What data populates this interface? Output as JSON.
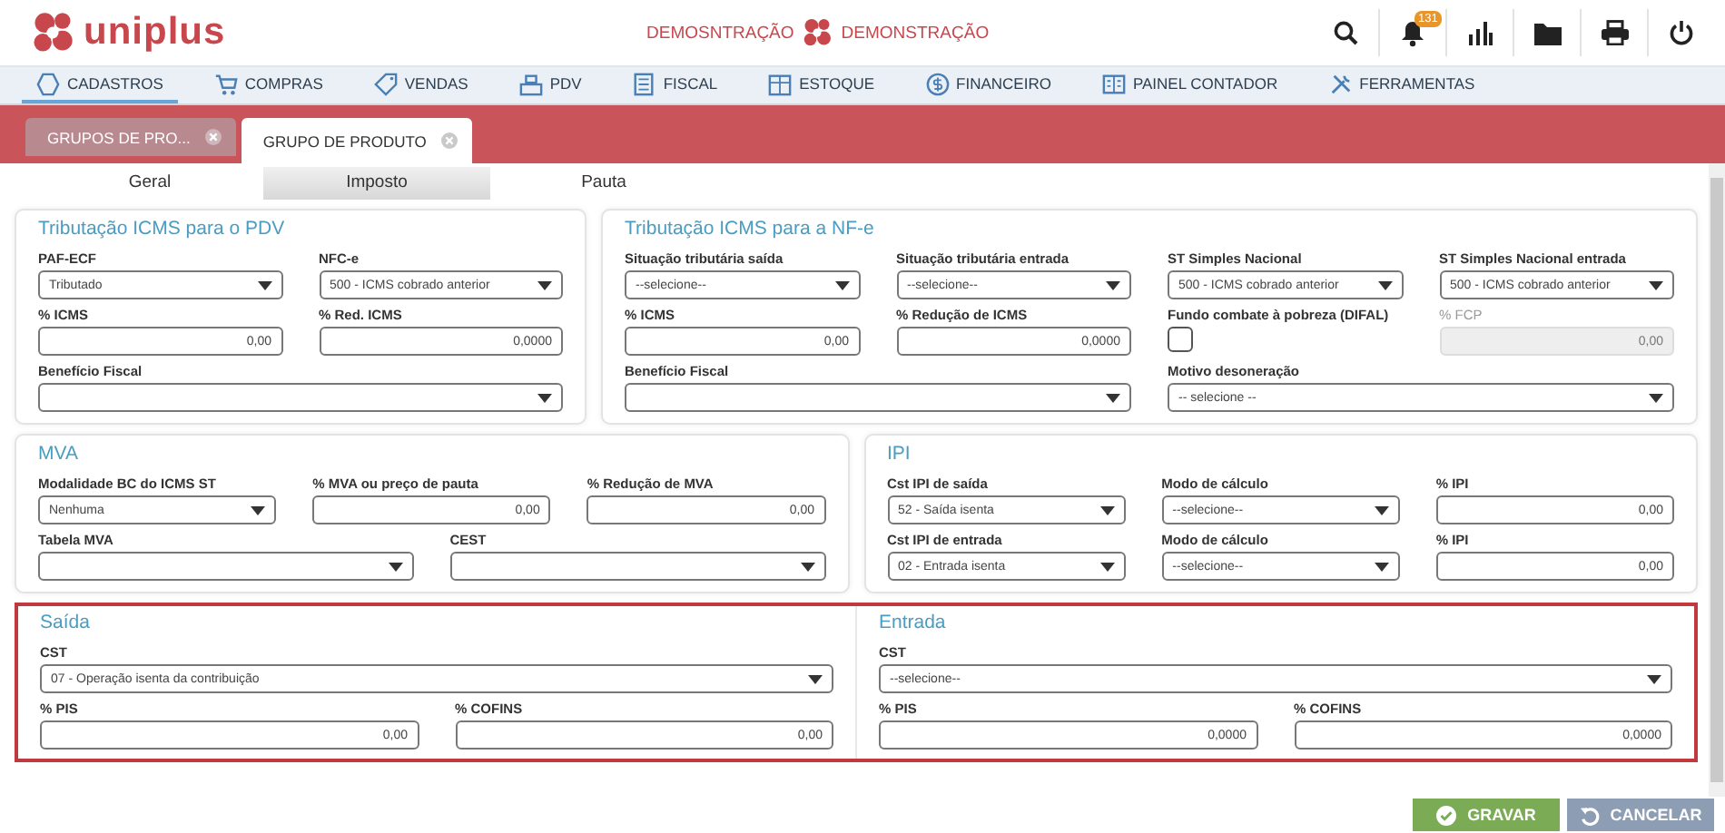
{
  "header": {
    "logo_text": "uniplus",
    "company_left": "DEMOSNTRAÇÃO",
    "company_right": "DEMONSTRAÇÃO",
    "notification_count": "131"
  },
  "nav": [
    {
      "label": "CADASTROS",
      "selected": true
    },
    {
      "label": "COMPRAS",
      "selected": false
    },
    {
      "label": "VENDAS",
      "selected": false
    },
    {
      "label": "PDV",
      "selected": false
    },
    {
      "label": "FISCAL",
      "selected": false
    },
    {
      "label": "ESTOQUE",
      "selected": false
    },
    {
      "label": "FINANCEIRO",
      "selected": false
    },
    {
      "label": "PAINEL CONTADOR",
      "selected": false
    },
    {
      "label": "FERRAMENTAS",
      "selected": false
    }
  ],
  "doc_tabs": [
    {
      "label": "GRUPOS DE PRO...",
      "selected": false
    },
    {
      "label": "GRUPO DE PRODUTO",
      "selected": true
    }
  ],
  "form_tabs": [
    {
      "label": "Geral",
      "selected": false
    },
    {
      "label": "Imposto",
      "selected": true
    },
    {
      "label": "Pauta",
      "selected": false
    }
  ],
  "sections": [
    {
      "highlighted": false,
      "panels": [
        {
          "title": "Tributação ICMS para o PDV",
          "field_lines": [
            {
              "fields": [
                {
                  "label": "PAF-ECF",
                  "kind": "select",
                  "value": "Tributado"
                },
                {
                  "label": "NFC-e",
                  "kind": "select",
                  "value": "500 - ICMS cobrado anterior"
                }
              ]
            },
            {
              "fields": [
                {
                  "label": "% ICMS",
                  "kind": "input",
                  "value": "0,00",
                  "disabled": false
                },
                {
                  "label": "% Red. ICMS",
                  "kind": "input",
                  "value": "0,0000",
                  "disabled": false
                }
              ]
            },
            {
              "fields": [
                {
                  "label": "Benefício Fiscal",
                  "kind": "select"
                }
              ]
            }
          ]
        },
        {
          "title": "Tributação ICMS para a NF-e",
          "field_lines": [
            {
              "fields": [
                {
                  "label": "Situação tributária saída",
                  "kind": "select",
                  "value": "--selecione--"
                },
                {
                  "label": "Situação tributária entrada",
                  "kind": "select",
                  "value": "--selecione--"
                },
                {
                  "label": "ST Simples Nacional",
                  "kind": "select",
                  "value": "500 - ICMS cobrado anterior"
                },
                {
                  "label": "ST Simples Nacional entrada",
                  "kind": "select",
                  "value": "500 - ICMS cobrado anterior"
                }
              ]
            },
            {
              "fields": [
                {
                  "label": "% ICMS",
                  "kind": "input",
                  "value": "0,00",
                  "disabled": false
                },
                {
                  "label": "% Redução de ICMS",
                  "kind": "input",
                  "value": "0,0000",
                  "disabled": false
                },
                {
                  "label": "Fundo combate à pobreza (DIFAL)",
                  "kind": "checkbox",
                  "checked": false
                },
                {
                  "label": "% FCP",
                  "kind": "input",
                  "value": "0,00",
                  "disabled": true
                }
              ]
            },
            {
              "fields": [
                {
                  "label": "Benefício Fiscal",
                  "kind": "select"
                },
                {
                  "label": "Motivo desoneração",
                  "kind": "select",
                  "value": "-- selecione --"
                }
              ]
            }
          ]
        }
      ]
    },
    {
      "highlighted": false,
      "panels": [
        {
          "title": "MVA",
          "field_lines": [
            {
              "fields": [
                {
                  "label": "Modalidade BC do ICMS ST",
                  "kind": "select",
                  "value": "Nenhuma"
                },
                {
                  "label": "% MVA ou preço de pauta",
                  "kind": "input",
                  "value": "0,00",
                  "disabled": false
                },
                {
                  "label": "% Redução de MVA",
                  "kind": "input",
                  "value": "0,00",
                  "disabled": false
                }
              ]
            },
            {
              "fields": [
                {
                  "label": "Tabela MVA",
                  "kind": "select"
                },
                {
                  "label": "CEST",
                  "kind": "select"
                }
              ]
            }
          ]
        },
        {
          "title": "IPI",
          "field_lines": [
            {
              "fields": [
                {
                  "label": "Cst IPI de saída",
                  "kind": "select",
                  "value": "52 - Saída isenta"
                },
                {
                  "label": "Modo de cálculo",
                  "kind": "select",
                  "value": "--selecione--"
                },
                {
                  "label": "% IPI",
                  "kind": "input",
                  "value": "0,00",
                  "disabled": false
                }
              ]
            },
            {
              "fields": [
                {
                  "label": "Cst IPI de entrada",
                  "kind": "select",
                  "value": "02 - Entrada isenta"
                },
                {
                  "label": "Modo de cálculo",
                  "kind": "select",
                  "value": "--selecione--"
                },
                {
                  "label": "% IPI",
                  "kind": "input",
                  "value": "0,00",
                  "disabled": false
                }
              ]
            }
          ]
        }
      ]
    },
    {
      "highlighted": true,
      "panels": [
        {
          "title": "Saída",
          "field_lines": [
            {
              "fields": [
                {
                  "label": "CST",
                  "kind": "select",
                  "value": "07 - Operação isenta da contribuição"
                }
              ]
            },
            {
              "fields": [
                {
                  "label": "% PIS",
                  "kind": "input",
                  "value": "0,00",
                  "disabled": false
                },
                {
                  "label": "% COFINS",
                  "kind": "input",
                  "value": "0,00",
                  "disabled": false
                }
              ]
            }
          ]
        },
        {
          "title": "Entrada",
          "field_lines": [
            {
              "fields": [
                {
                  "label": "CST",
                  "kind": "select",
                  "value": "--selecione--"
                }
              ]
            },
            {
              "fields": [
                {
                  "label": "% PIS",
                  "kind": "input",
                  "value": "0,0000",
                  "disabled": false
                },
                {
                  "label": "% COFINS",
                  "kind": "input",
                  "value": "0,0000",
                  "disabled": false
                }
              ]
            }
          ]
        }
      ]
    }
  ],
  "buttons": [
    {
      "label": "GRAVAR",
      "kind": "save"
    },
    {
      "label": "CANCELAR",
      "kind": "cancel"
    }
  ]
}
